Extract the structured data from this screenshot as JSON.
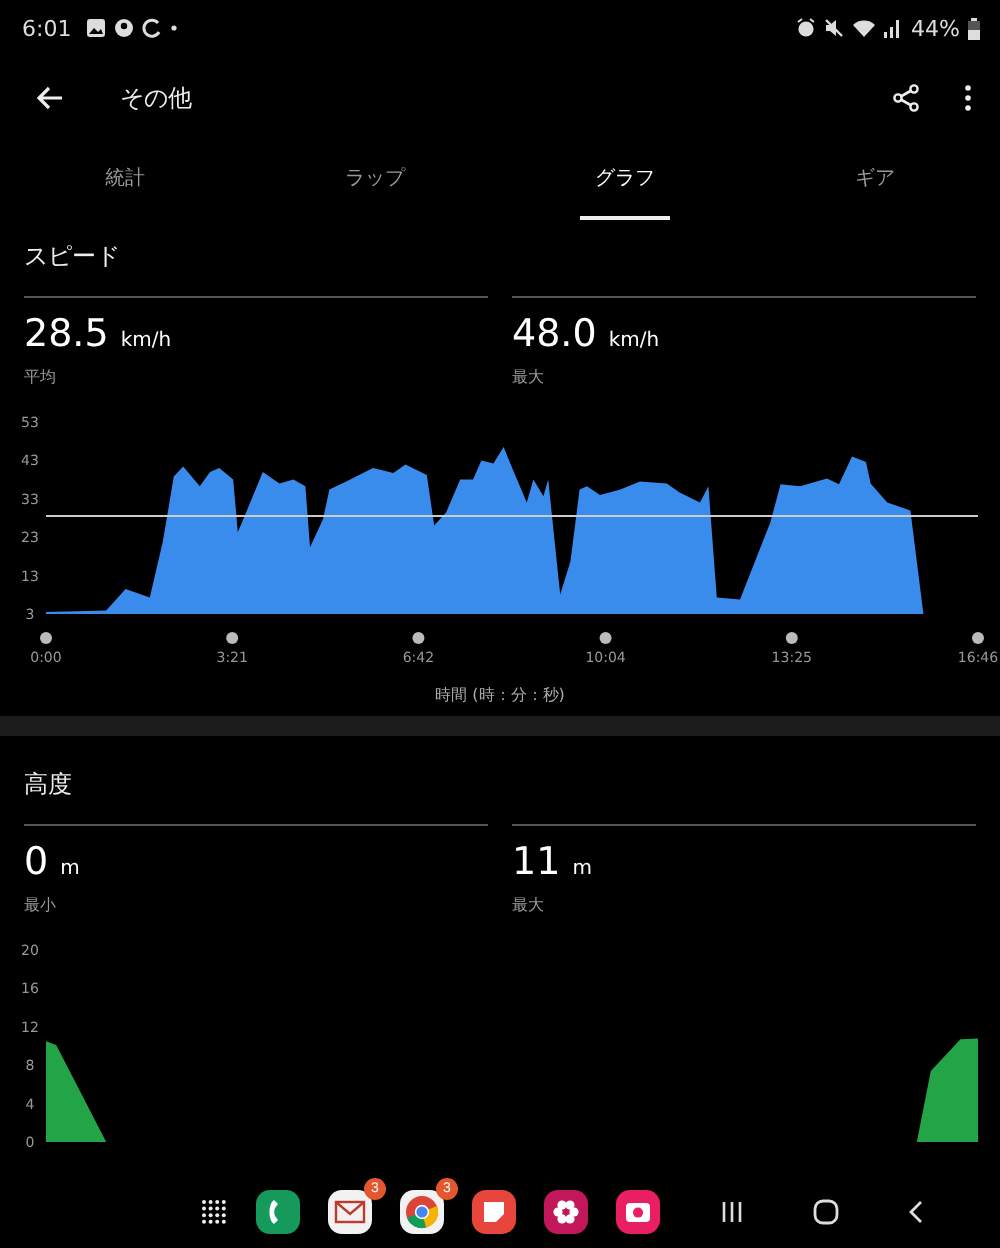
{
  "status_bar": {
    "time": "6:01",
    "battery": "44%"
  },
  "header": {
    "title": "その他"
  },
  "tabs": [
    {
      "label": "統計",
      "selected": false
    },
    {
      "label": "ラップ",
      "selected": false
    },
    {
      "label": "グラフ",
      "selected": true
    },
    {
      "label": "ギア",
      "selected": false
    }
  ],
  "sections": [
    {
      "title": "スピード",
      "stats": [
        {
          "value": "28.5",
          "unit": "km/h",
          "label": "平均"
        },
        {
          "value": "48.0",
          "unit": "km/h",
          "label": "最大"
        }
      ],
      "chart_data": {
        "type": "area",
        "xlabel": "時間 (時：分：秒)",
        "xlim": [
          0,
          1006
        ],
        "ylim": [
          3,
          53
        ],
        "yticks": [
          3,
          13,
          23,
          33,
          43,
          53
        ],
        "xticks": [
          {
            "value": 0,
            "label": "0:00"
          },
          {
            "value": 201,
            "label": "3:21"
          },
          {
            "value": 402,
            "label": "6:42"
          },
          {
            "value": 604,
            "label": "10:04"
          },
          {
            "value": 805,
            "label": "13:25"
          },
          {
            "value": 1006,
            "label": "16:46"
          }
        ],
        "x": [
          0,
          65,
          86,
          112,
          126,
          138,
          148,
          166,
          177,
          187,
          202,
          207,
          216,
          234,
          252,
          267,
          280,
          285,
          299,
          306,
          324,
          353,
          375,
          388,
          411,
          419,
          432,
          447,
          461,
          470,
          483,
          494,
          504,
          519,
          526,
          537,
          542,
          555,
          566,
          576,
          584,
          598,
          620,
          641,
          670,
          684,
          706,
          715,
          724,
          749,
          782,
          793,
          814,
          843,
          856,
          870,
          885,
          890,
          908,
          933,
          947,
          1006
        ],
        "series": [
          {
            "color": "#3a8cec",
            "values": [
              3.5,
              3.9,
              9.5,
              7.3,
              21.8,
              38.8,
              41.4,
              36.3,
              40,
              41,
              38,
              24.3,
              29.5,
              40,
              37,
              38,
              36.3,
              20.4,
              27.7,
              35.4,
              37.5,
              41,
              39.7,
              41.9,
              39.2,
              26,
              29.5,
              38,
              38,
              43,
              42.2,
              46.5,
              40.5,
              32,
              38,
              33.7,
              38,
              8.1,
              16.7,
              35.4,
              36.3,
              34,
              35.4,
              37.5,
              37,
              34.6,
              32,
              36.3,
              7.3,
              6.8,
              26.9,
              36.8,
              36.3,
              38.3,
              36.8,
              44,
              42.6,
              37,
              32,
              30,
              3,
              3
            ]
          }
        ],
        "ref_lines": [
          {
            "axis": "y",
            "value": 28.5
          }
        ]
      }
    },
    {
      "title": "高度",
      "stats": [
        {
          "value": "0",
          "unit": "m",
          "label": "最小"
        },
        {
          "value": "11",
          "unit": "m",
          "label": "最大"
        }
      ],
      "chart_data": {
        "type": "area",
        "xlim": [
          0,
          1006
        ],
        "ylim": [
          0,
          20
        ],
        "yticks": [
          0,
          4,
          8,
          12,
          16,
          20
        ],
        "x": [
          0,
          11,
          65,
          940,
          955,
          987,
          1006
        ],
        "series": [
          {
            "color": "#22a447",
            "values": [
              10.5,
              10.1,
              0,
              0,
              7.4,
              10.7,
              10.8
            ]
          }
        ]
      }
    }
  ],
  "nav_bar": {
    "apps": [
      {
        "kind": "apps"
      },
      {
        "kind": "phone"
      },
      {
        "kind": "mail",
        "badge": "3"
      },
      {
        "kind": "browser",
        "badge": "3"
      },
      {
        "kind": "notes"
      },
      {
        "kind": "flower"
      },
      {
        "kind": "camera"
      }
    ]
  }
}
